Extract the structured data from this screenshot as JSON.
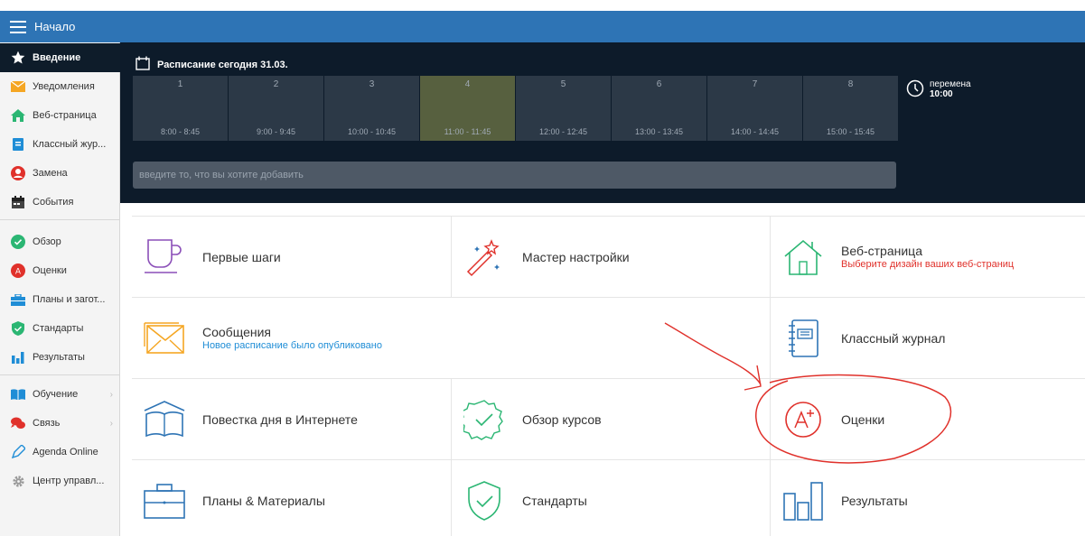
{
  "topbar": {
    "title": "Начало",
    "menu_icon": "hamburger-icon"
  },
  "sidebar": {
    "items": [
      {
        "label": "Введение",
        "icon": "star-icon",
        "active": true
      },
      {
        "label": "Уведомления",
        "icon": "envelope-icon"
      },
      {
        "label": "Веб-страница",
        "icon": "home-icon"
      },
      {
        "label": "Классный жур...",
        "icon": "journal-icon"
      },
      {
        "label": "Замена",
        "icon": "person-icon"
      },
      {
        "label": "События",
        "icon": "calendar-icon"
      },
      {
        "label": "Обзор",
        "icon": "check-circle-icon"
      },
      {
        "label": "Оценки",
        "icon": "grade-icon"
      },
      {
        "label": "Планы и загот...",
        "icon": "briefcase-icon"
      },
      {
        "label": "Стандарты",
        "icon": "shield-icon"
      },
      {
        "label": "Результаты",
        "icon": "bar-chart-icon"
      },
      {
        "label": "Обучение",
        "icon": "book-icon",
        "has_submenu": true
      },
      {
        "label": "Связь",
        "icon": "chat-icon",
        "has_submenu": true
      },
      {
        "label": "Agenda Online",
        "icon": "pen-icon"
      },
      {
        "label": "Центр управл...",
        "icon": "gear-icon"
      }
    ]
  },
  "schedule": {
    "title": "Расписание сегодня 31.03.",
    "periods": [
      {
        "num": "1",
        "time": "8:00 - 8:45"
      },
      {
        "num": "2",
        "time": "9:00 - 9:45"
      },
      {
        "num": "3",
        "time": "10:00 - 10:45"
      },
      {
        "num": "4",
        "time": "11:00 - 11:45",
        "current": true
      },
      {
        "num": "5",
        "time": "12:00 - 12:45"
      },
      {
        "num": "6",
        "time": "13:00 - 13:45"
      },
      {
        "num": "7",
        "time": "14:00 - 14:45"
      },
      {
        "num": "8",
        "time": "15:00 - 15:45"
      }
    ],
    "break_label": "перемена",
    "break_time": "10:00",
    "add_placeholder": "введите то, что вы хотите добавить"
  },
  "tiles": [
    {
      "title": "Первые шаги",
      "icon": "cup-icon"
    },
    {
      "title": "Мастер настройки",
      "icon": "magic-wand-icon"
    },
    {
      "title": "Веб-страница",
      "subtitle": "Выберите дизайн ваших веб-страниц",
      "icon": "home-icon"
    },
    {
      "title": "Сообщения",
      "subtitle": "Новое расписание было опубликовано",
      "icon": "envelope-icon"
    },
    {
      "title": "Классный журнал",
      "icon": "journal-icon"
    },
    {
      "title": "Повестка дня в Интернете",
      "icon": "open-book-icon"
    },
    {
      "title": "Обзор курсов",
      "icon": "check-badge-icon"
    },
    {
      "title": "Оценки",
      "icon": "grade-a-plus-icon"
    },
    {
      "title": "Планы & Материалы",
      "icon": "briefcase-icon"
    },
    {
      "title": "Стандарты",
      "icon": "shield-check-icon"
    },
    {
      "title": "Результаты",
      "icon": "bar-chart-icon"
    }
  ],
  "colors": {
    "topbar": "#2e74b5",
    "schedule_bg": "#0d1b2a",
    "current_period": "#57603f",
    "annotation": "#e0312b"
  }
}
